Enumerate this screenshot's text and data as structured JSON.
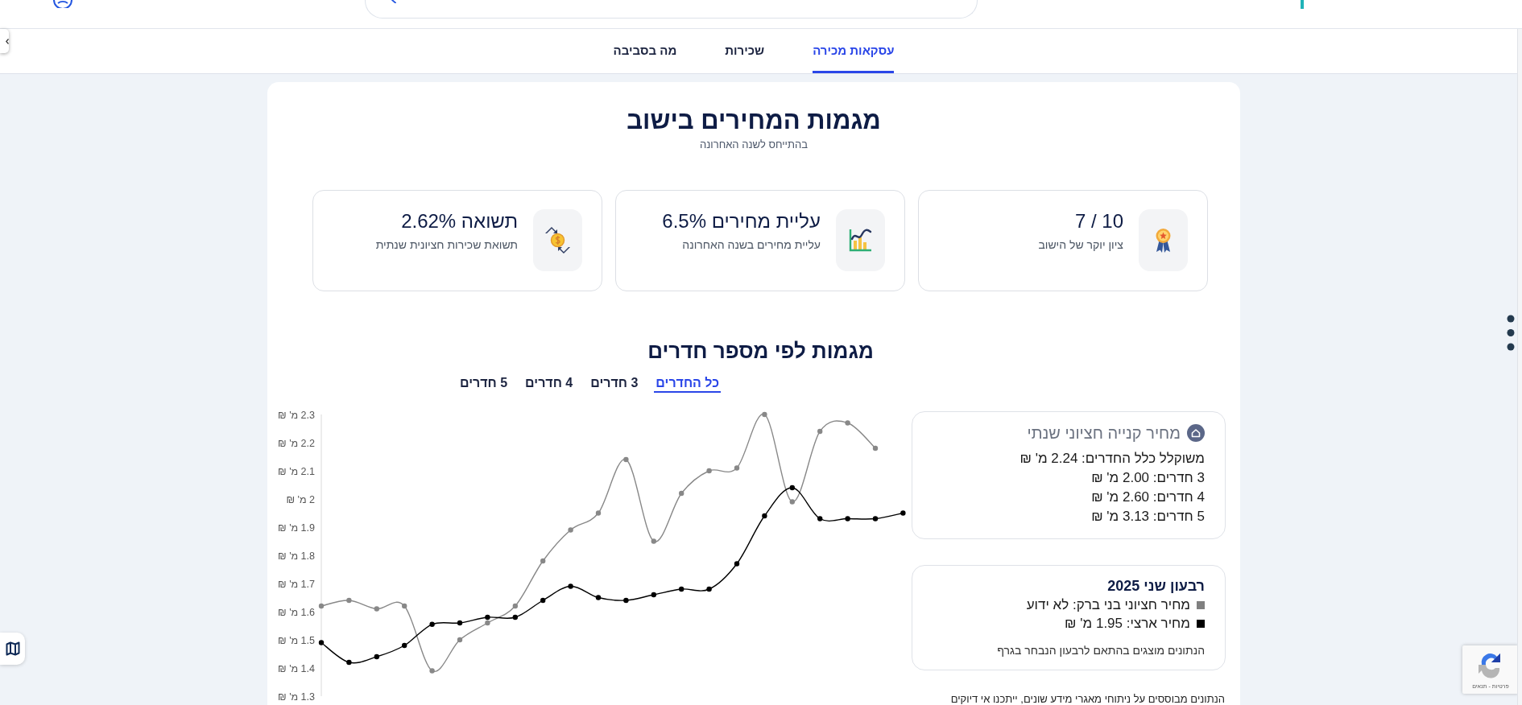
{
  "nav_tabs": [
    {
      "label": "עסקאות מכירה",
      "selected": true
    },
    {
      "label": "שכירות",
      "selected": false
    },
    {
      "label": "מה בסביבה",
      "selected": false
    }
  ],
  "trends": {
    "title": "מגמות המחירים בישוב",
    "subtitle": "בהתייחס לשנה האחרונה",
    "stats": [
      {
        "kind": "score",
        "value": "7 / 10",
        "label": "ציון יוקר של הישוב"
      },
      {
        "kind": "rise",
        "value": "עליית מחירים 6.5%",
        "label": "עליית מחירים בשנה האחרונה"
      },
      {
        "kind": "yield",
        "value": "תשואה 2.62%",
        "label": "תשואת שכירות חציונית שנתית"
      }
    ]
  },
  "rooms": {
    "title": "מגמות לפי מספר חדרים",
    "tabs": [
      {
        "label": "כל החדרים",
        "selected": true
      },
      {
        "label": "3 חדרים",
        "selected": false
      },
      {
        "label": "4 חדרים",
        "selected": false
      },
      {
        "label": "5 חדרים",
        "selected": false
      }
    ],
    "chart_data": {
      "type": "line",
      "ylim": [
        1.3,
        2.3
      ],
      "yticks": [
        {
          "value": 2.3,
          "label": "2.3 מ' ₪"
        },
        {
          "value": 2.2,
          "label": "2.2 מ' ₪"
        },
        {
          "value": 2.1,
          "label": "2.1 מ' ₪"
        },
        {
          "value": 2,
          "label": "2 מ' ₪"
        },
        {
          "value": 1.9,
          "label": "1.9 מ' ₪"
        },
        {
          "value": 1.8,
          "label": "1.8 מ' ₪"
        },
        {
          "value": 1.7,
          "label": "1.7 מ' ₪"
        },
        {
          "value": 1.6,
          "label": "1.6 מ' ₪"
        },
        {
          "value": 1.5,
          "label": "1.5 מ' ₪"
        },
        {
          "value": 1.4,
          "label": "1.4 מ' ₪"
        },
        {
          "value": 1.3,
          "label": "1.3 מ' ₪"
        }
      ],
      "series": [
        {
          "color": "#888888",
          "marker": "circle",
          "values": [
            1.62,
            1.64,
            1.61,
            1.62,
            1.39,
            1.5,
            1.56,
            1.62,
            1.78,
            1.89,
            1.95,
            2.14,
            1.85,
            2.02,
            2.1,
            2.11,
            2.3,
            1.99,
            2.24,
            2.27,
            2.18,
            null
          ]
        },
        {
          "color": "#000000",
          "marker": "circle",
          "values": [
            1.49,
            1.42,
            1.44,
            1.48,
            1.555,
            1.56,
            1.58,
            1.58,
            1.64,
            1.69,
            1.65,
            1.64,
            1.66,
            1.68,
            1.68,
            1.77,
            1.94,
            2.04,
            1.93,
            1.93,
            1.93,
            1.95
          ]
        }
      ]
    }
  },
  "median_price": {
    "title": "מחיר קנייה חציוני שנתי",
    "lines": [
      "משוקלל כלל החדרים: 2.24 מ' ₪",
      "3 חדרים: 2.00 מ' ₪",
      "4 חדרים: 2.60 מ' ₪",
      "5 חדרים: 3.13 מ' ₪"
    ]
  },
  "quarter": {
    "title": "רבעון שני 2025",
    "legend": [
      {
        "label": "מחיר חציוני בני ברק: לא ידוע",
        "color": "#808080"
      },
      {
        "label": "מחיר ארצי: 1.95 מ' ₪",
        "color": "#000000"
      }
    ],
    "note": "הנתונים מוצגים בהתאם לרבעון הנבחר בגרף"
  },
  "disclaimer": "הנתונים מבוססים על ניתוחי מאגרי מידע שונים, ייתכנו אי דיוקים",
  "captcha": {
    "links": "פרטיות - תנאים"
  }
}
